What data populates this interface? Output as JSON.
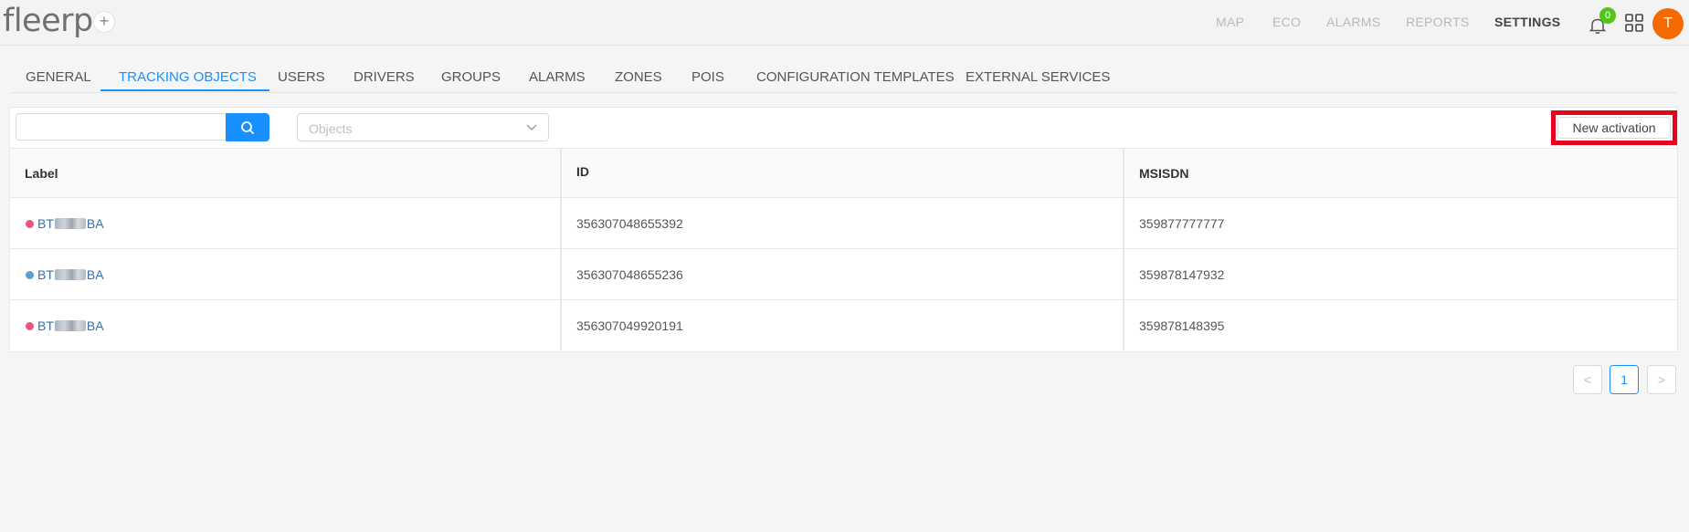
{
  "header": {
    "logo": "fleerp",
    "nav": [
      {
        "label": "MAP",
        "active": false
      },
      {
        "label": "ECO",
        "active": false
      },
      {
        "label": "ALARMS",
        "active": false
      },
      {
        "label": "REPORTS",
        "active": false
      },
      {
        "label": "SETTINGS",
        "active": true
      }
    ],
    "notifications_count": "0",
    "user_initial": "T"
  },
  "tabs": [
    "GENERAL",
    "TRACKING OBJECTS",
    "USERS",
    "DRIVERS",
    "GROUPS",
    "ALARMS",
    "ZONES",
    "POIS",
    "CONFIGURATION TEMPLATES",
    "EXTERNAL SERVICES"
  ],
  "active_tab": "TRACKING OBJECTS",
  "toolbar": {
    "search_value": "",
    "objects_placeholder": "Objects",
    "new_activation_label": "New activation"
  },
  "table": {
    "columns": [
      "Label",
      "ID",
      "MSISDN"
    ],
    "rows": [
      {
        "label_prefix": "BT",
        "label_suffix": "BA",
        "status_color": "#e8587a",
        "id": "356307048655392",
        "msisdn": "359877777777"
      },
      {
        "label_prefix": "BT",
        "label_suffix": "BA",
        "status_color": "#5aa0d0",
        "id": "356307048655236",
        "msisdn": "359878147932"
      },
      {
        "label_prefix": "BT",
        "label_suffix": "BA",
        "status_color": "#e8587a",
        "id": "356307049920191",
        "msisdn": "359878148395"
      }
    ]
  },
  "pagination": {
    "prev": "<",
    "current": "1",
    "next": ">"
  },
  "colors": {
    "accent": "#1890ff",
    "highlight_box": "#e8001c",
    "avatar": "#f56a00",
    "badge": "#52c41a"
  }
}
